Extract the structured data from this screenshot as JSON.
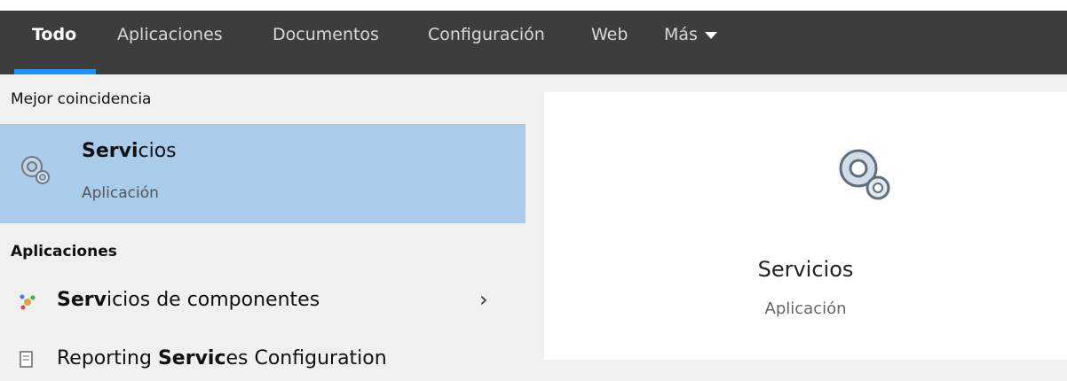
{
  "tabs": [
    {
      "label": "Todo",
      "active": true
    },
    {
      "label": "Aplicaciones",
      "active": false
    },
    {
      "label": "Documentos",
      "active": false
    },
    {
      "label": "Configuración",
      "active": false
    },
    {
      "label": "Web",
      "active": false
    },
    {
      "label": "Más",
      "active": false
    }
  ],
  "colors": {
    "accent": "#1e90ff",
    "selection": "#a9ccea",
    "topbar": "#3d3d3d"
  },
  "left": {
    "best_match_title": "Mejor coincidencia",
    "best_match": {
      "title_bold": "Servi",
      "title_rest": "cios",
      "subtitle": "Aplicación",
      "icon": "gears-icon"
    },
    "apps_title": "Aplicaciones",
    "items": [
      {
        "bold": "Serv",
        "rest": "icios de componentes",
        "icon": "component-services-icon",
        "has_arrow": true,
        "arrow": "›"
      },
      {
        "pre": "Reporting ",
        "bold": "Servic",
        "rest": "es Configuration",
        "icon": "document-icon",
        "has_arrow": false
      }
    ]
  },
  "preview": {
    "title": "Servicios",
    "subtitle": "Aplicación",
    "icon": "gears-icon"
  }
}
